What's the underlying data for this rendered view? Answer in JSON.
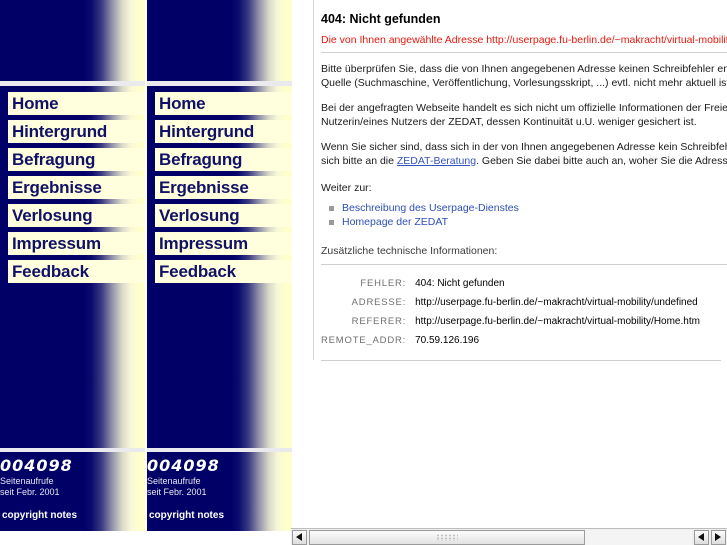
{
  "sidebar": {
    "nav_items": [
      {
        "label": "Home"
      },
      {
        "label": "Hintergrund"
      },
      {
        "label": "Befragung"
      },
      {
        "label": "Ergebnisse"
      },
      {
        "label": "Verlosung"
      },
      {
        "label": "Impressum"
      },
      {
        "label": "Feedback"
      }
    ],
    "counter_value": "004098",
    "counter_label_line1": "Seitenaufrufe",
    "counter_label_line2": "seit Febr. 2001",
    "copyright_label": "copyright notes"
  },
  "main": {
    "error_title": "404: Nicht gefunden",
    "error_subtitle": "Die von Ihnen angewählte Adresse http://userpage.fu-berlin.de/~makracht/virtual-mobility/undefined",
    "paragraphs": [
      {
        "line1": "Bitte überprüfen Sie, dass die von Ihnen angegebenen Adresse keinen Schreibfehler enthält und ob die",
        "line2": "Quelle (Suchmaschine, Veröffentlichung, Vorlesungsskript, ...) evtl. nicht mehr aktuell ist."
      },
      {
        "line1": "Bei der angefragten Webseite handelt es sich nicht um offizielle Informationen der Freien Universität,",
        "line2": "Nutzerin/eines Nutzers der ZEDAT, dessen Kontinuität u.U. weniger gesichert ist."
      }
    ],
    "para3_part1": "Wenn Sie sicher sind, dass sich in der von Ihnen angegebenen Adresse kein Schreibfehler befindet,",
    "para3_part2": "sich bitte an die ",
    "para3_link": "ZEDAT-Beratung",
    "para3_part3": ". Geben Sie dabei bitte auch an, woher Sie die Adresse erhalten",
    "weiter_label": "Weiter zur:",
    "links": [
      {
        "label": "Beschreibung des Userpage-Dienstes"
      },
      {
        "label": "Homepage der ZEDAT"
      }
    ],
    "tech_heading": "Zusätzliche technische Informationen:",
    "tech_rows": [
      {
        "key": "FEHLER:",
        "value": "404: Nicht gefunden"
      },
      {
        "key": "ADRESSE:",
        "value": "http://userpage.fu-berlin.de/~makracht/virtual-mobility/undefined"
      },
      {
        "key": "REFERER:",
        "value": "http://userpage.fu-berlin.de/~makracht/virtual-mobility/Home.htm"
      },
      {
        "key": "REMOTE_ADDR:",
        "value": "70.59.126.196"
      }
    ]
  },
  "scrollbar": {
    "left_arrow": "◀",
    "right_arrow": "▶",
    "thumb_position_pct": 0
  },
  "colors": {
    "navy": "#000066",
    "cream": "#ffffcc",
    "nav_item_bg": "#ffffdd",
    "nav_item_text": "#111166",
    "error_red": "#e8180c",
    "link_blue": "#2d4fb5",
    "tech_key_gray": "#6f6f6f"
  }
}
